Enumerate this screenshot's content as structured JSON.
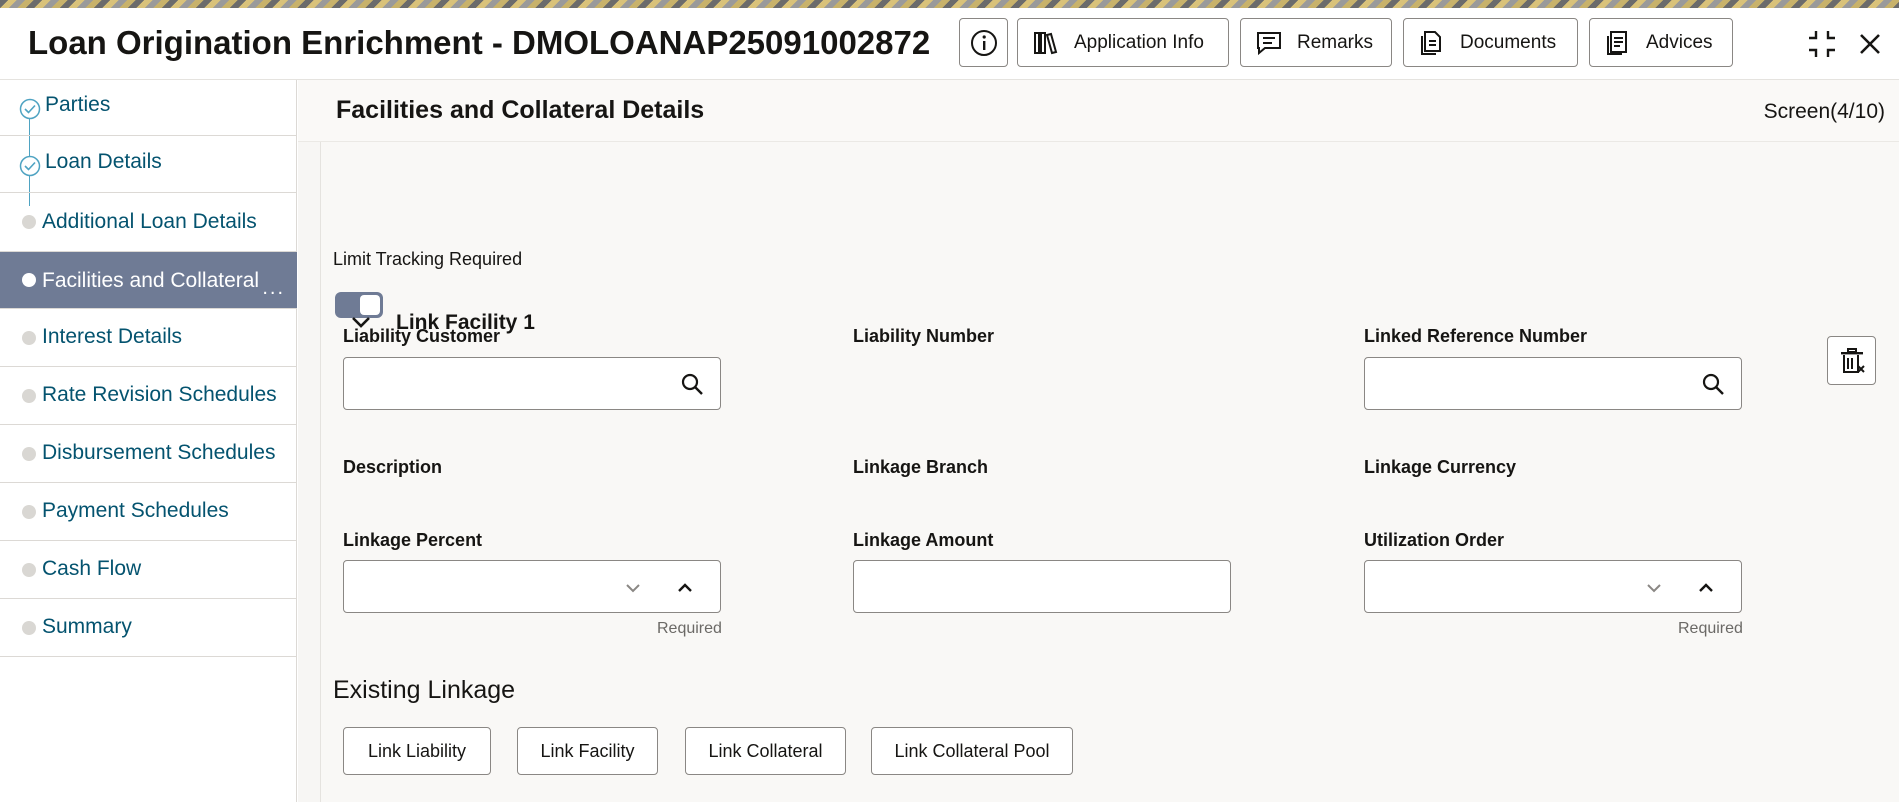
{
  "header": {
    "title": "Loan Origination Enrichment - DMOLOANAP25091002872",
    "buttons": {
      "application_info": "Application Info",
      "remarks": "Remarks",
      "documents": "Documents",
      "advices": "Advices"
    }
  },
  "sidebar": {
    "items": [
      {
        "label": "Parties",
        "state": "completed"
      },
      {
        "label": "Loan Details",
        "state": "completed"
      },
      {
        "label": "Additional Loan Details",
        "state": "pending"
      },
      {
        "label": "Facilities and Collateral",
        "state": "active"
      },
      {
        "label": "Interest Details",
        "state": "pending"
      },
      {
        "label": "Rate Revision Schedules",
        "state": "pending"
      },
      {
        "label": "Disbursement Schedules",
        "state": "pending"
      },
      {
        "label": "Payment Schedules",
        "state": "pending"
      },
      {
        "label": "Cash Flow",
        "state": "pending"
      },
      {
        "label": "Summary",
        "state": "pending"
      }
    ],
    "more": "..."
  },
  "main": {
    "title": "Facilities and Collateral Details",
    "screen": "Screen(4/10)",
    "limit_tracking_label": "Limit Tracking Required",
    "limit_tracking_on": true,
    "link_facility_title": "Link Facility 1",
    "fields": {
      "liability_customer": {
        "label": "Liability Customer",
        "value": ""
      },
      "liability_number": {
        "label": "Liability Number"
      },
      "linked_reference_number": {
        "label": "Linked Reference Number",
        "value": ""
      },
      "description": {
        "label": "Description"
      },
      "linkage_branch": {
        "label": "Linkage Branch"
      },
      "linkage_currency": {
        "label": "Linkage Currency"
      },
      "linkage_percent": {
        "label": "Linkage Percent",
        "value": "",
        "hint": "Required"
      },
      "linkage_amount": {
        "label": "Linkage Amount",
        "value": ""
      },
      "utilization_order": {
        "label": "Utilization Order",
        "value": "",
        "hint": "Required"
      }
    },
    "existing_linkage": {
      "title": "Existing Linkage",
      "buttons": [
        "Link Liability",
        "Link Facility",
        "Link Collateral",
        "Link Collateral Pool"
      ]
    }
  },
  "colors": {
    "accent": "#6f7b95",
    "link_text": "#04536f",
    "check": "#4fa3c2"
  }
}
